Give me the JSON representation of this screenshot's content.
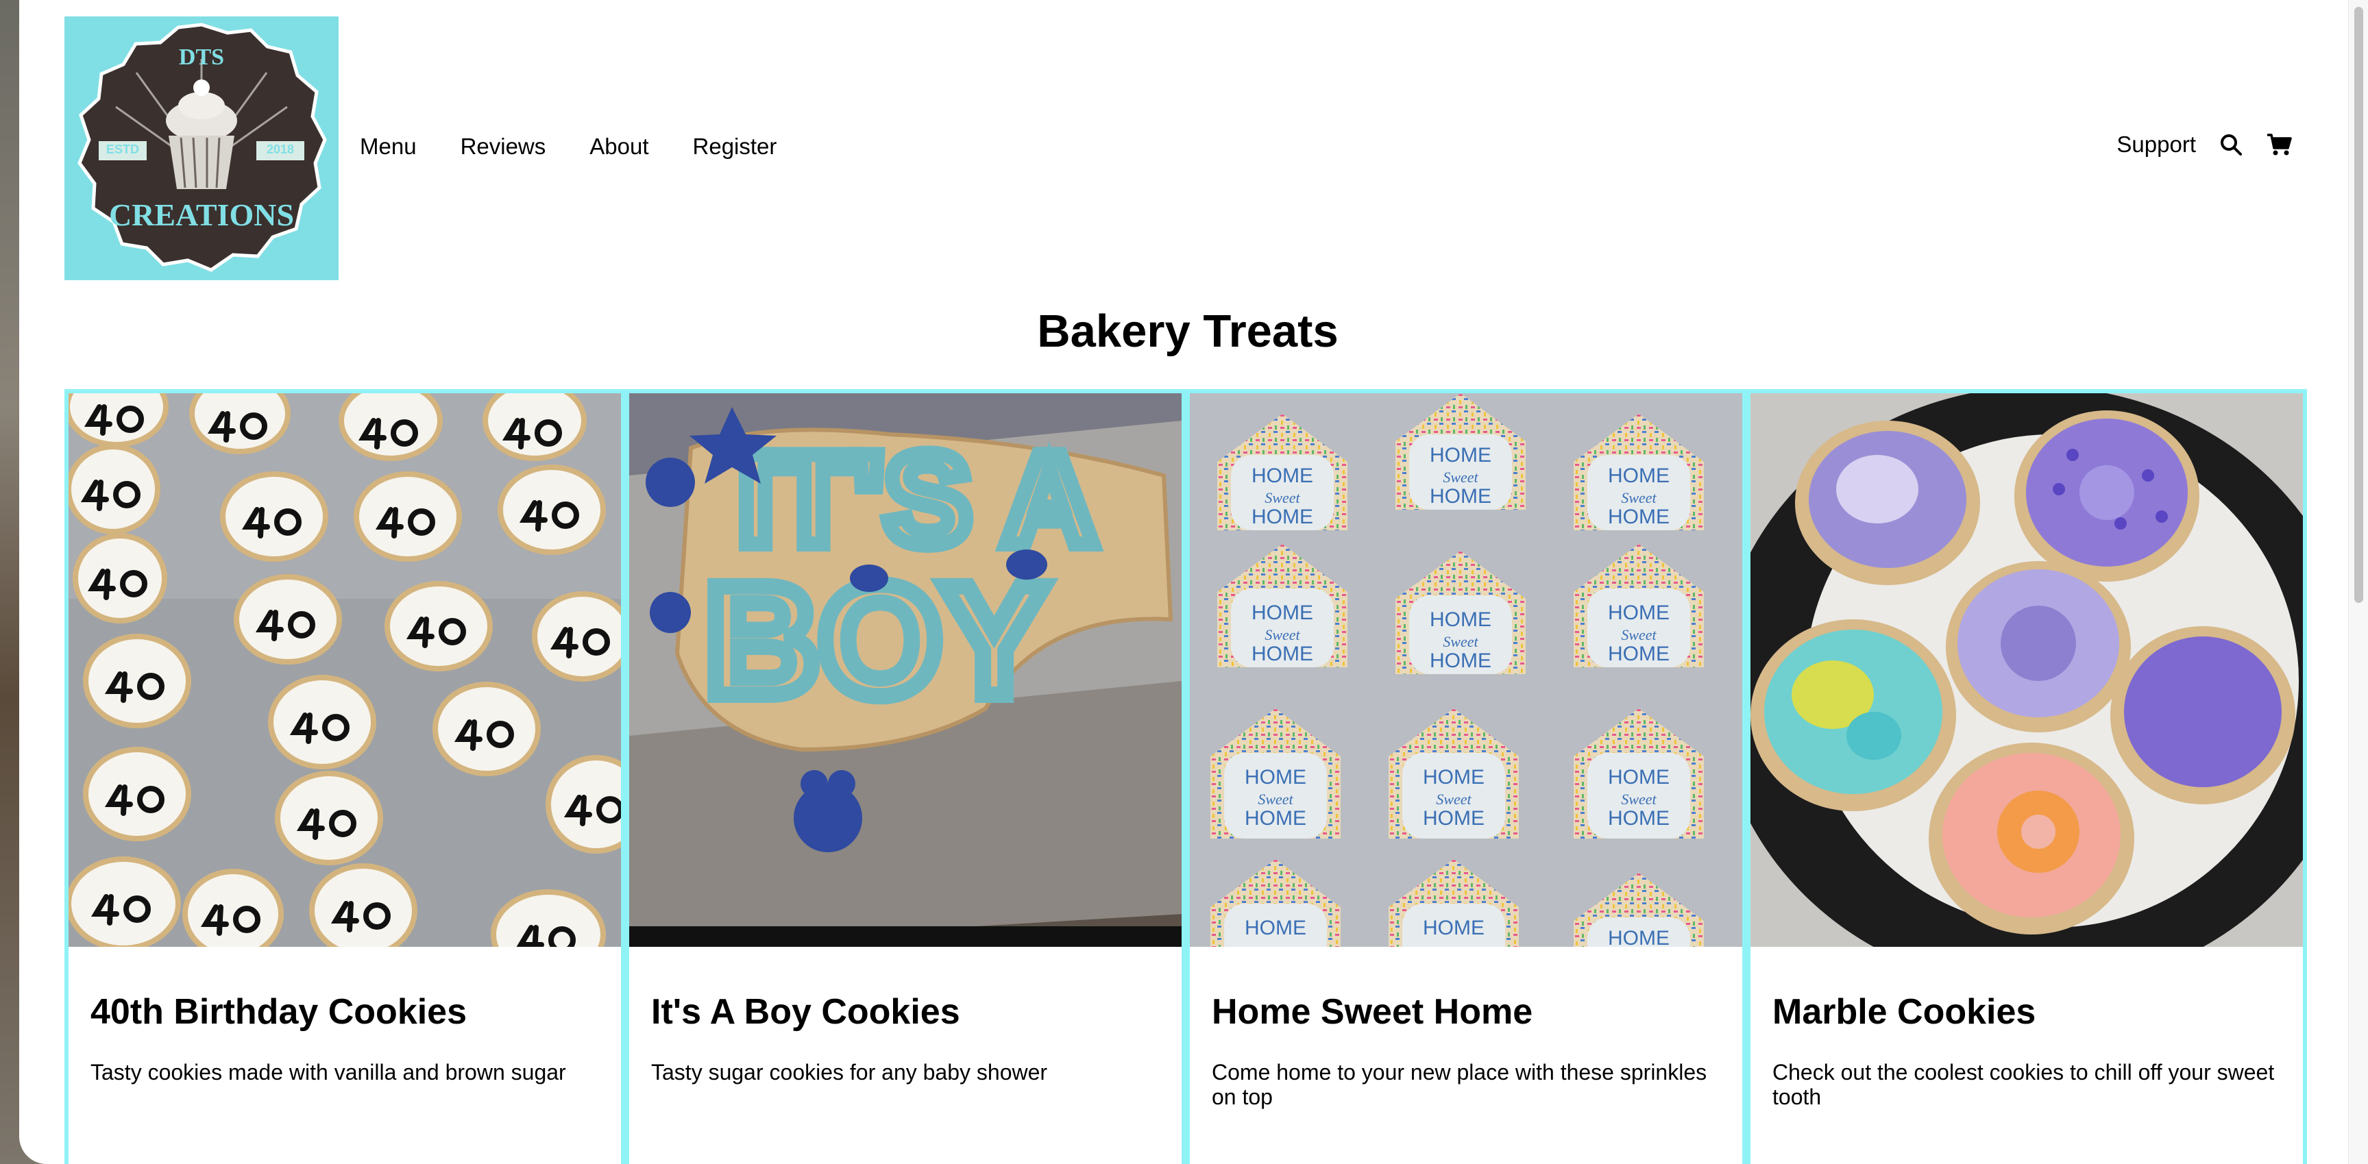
{
  "brand": {
    "logo_top_text": "DTS",
    "logo_bottom_text": "CREATIONS",
    "logo_left_badge": "ESTD",
    "logo_right_badge": "2018",
    "logo_bg_color": "#80dfe5"
  },
  "nav": {
    "items": [
      {
        "label": "Menu"
      },
      {
        "label": "Reviews"
      },
      {
        "label": "About"
      },
      {
        "label": "Register"
      }
    ]
  },
  "header_right": {
    "support_label": "Support",
    "search_icon": "search-icon",
    "cart_icon": "cart-icon"
  },
  "page": {
    "title": "Bakery Treats"
  },
  "products": [
    {
      "title": "40th Birthday Cookies",
      "description": "Tasty cookies made with vanilla and brown sugar"
    },
    {
      "title": "It's A Boy Cookies",
      "description": "Tasty sugar cookies for any baby shower",
      "image_text_line1": "IT'S A",
      "image_text_line2": "BOY"
    },
    {
      "title": "Home Sweet Home",
      "description": "Come home to your new place with these sprinkles on top",
      "cookie_text_top": "HOME",
      "cookie_text_mid": "Sweet",
      "cookie_text_bottom": "HOME"
    },
    {
      "title": "Marble Cookies",
      "description": "Check out the coolest cookies to chill off your sweet tooth"
    }
  ],
  "colors": {
    "card_border": "#8ff3f6",
    "accent": "#80dfe5"
  }
}
